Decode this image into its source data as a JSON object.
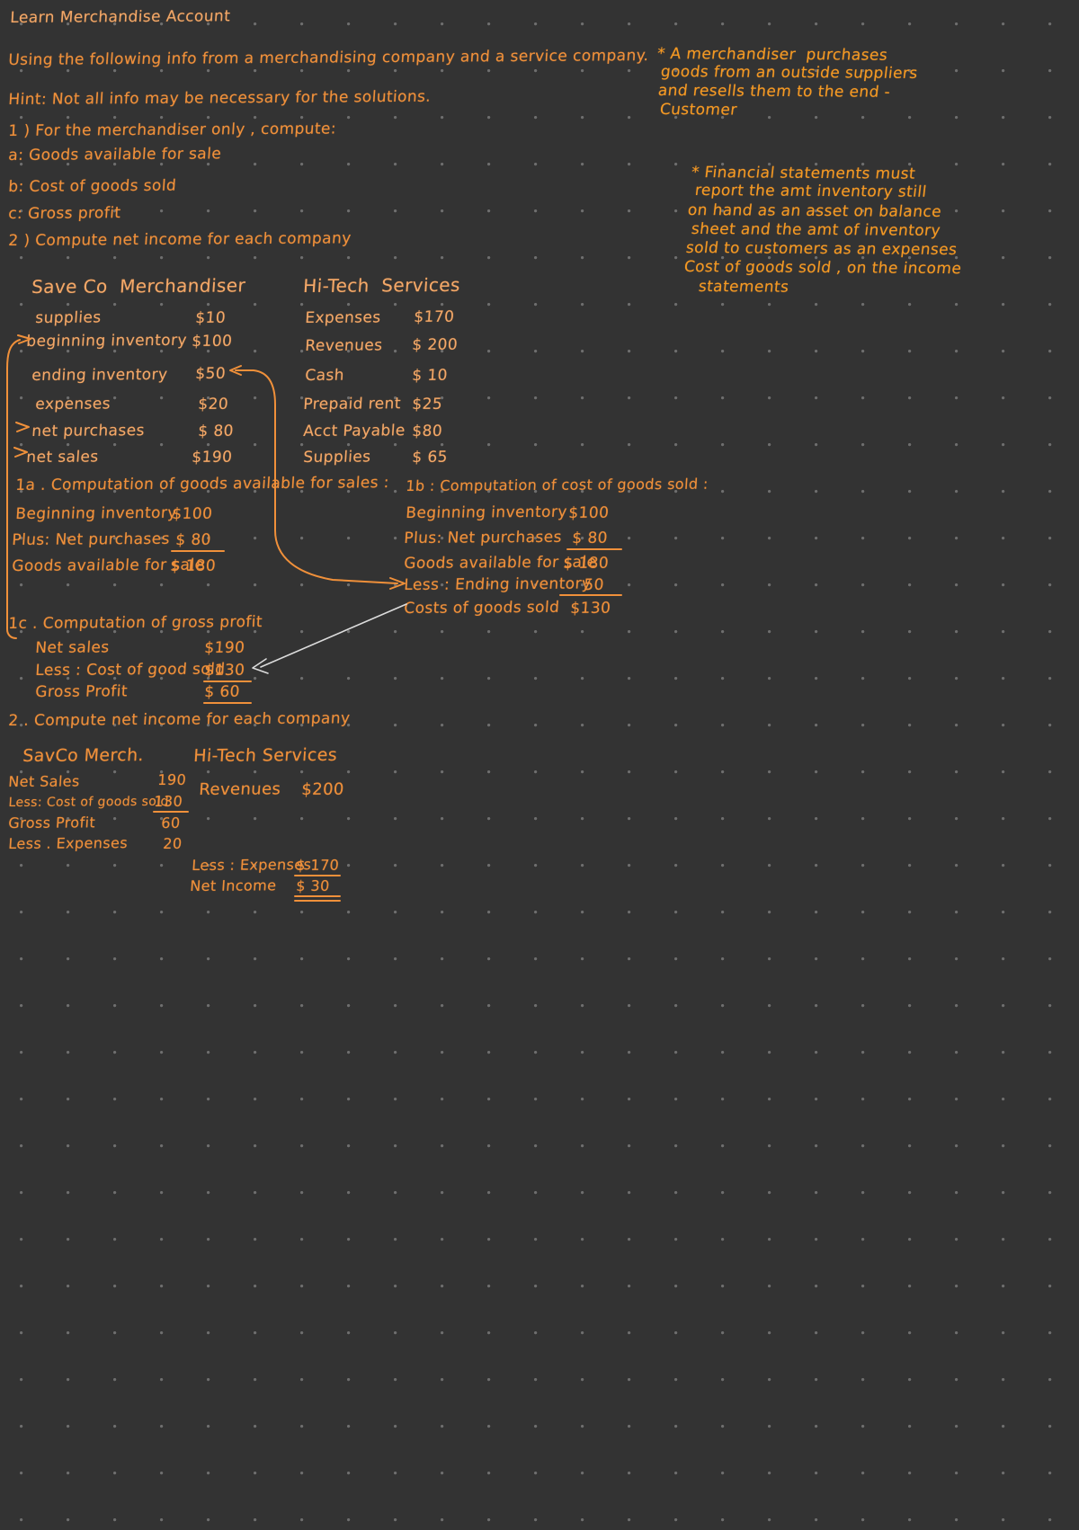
{
  "page": {
    "title": "Learn Merchandise Account",
    "background_color": "#333333",
    "ink_color": "#f0903a",
    "ink_color_bright": "#f59a22",
    "arrow_color": "#dcdcdc"
  },
  "intro": {
    "line1": "Using the following info from a merchandising company and a service company.",
    "line2": "Hint: Not all info may be necessary for the solutions.",
    "q1": "1 ) For the merchandiser only , compute:",
    "q1a": "a: Goods available for sale",
    "q1b": "b: Cost of goods sold",
    "q1c": "c: Gross profit",
    "q2": "2 ) Compute net income for each company"
  },
  "margin_notes": [
    {
      "id": "note-merchandiser",
      "lines": [
        "* A merchandiser  purchases",
        "goods from an outside suppliers",
        "and resells them to the end -",
        "Customer"
      ]
    },
    {
      "id": "note-financial-statements",
      "lines": [
        "* Financial statements must",
        "report the amt inventory still",
        "on hand as an asset on balance",
        "sheet and the amt of inventory",
        "sold to customers as an expenses",
        "Cost of goods sold , on the income",
        "statements"
      ]
    }
  ],
  "given_data": {
    "merchandiser": {
      "heading": "Save Co  Merchandiser",
      "rows": [
        {
          "label": "supplies",
          "value": "$10"
        },
        {
          "label": "beginning inventory",
          "value": "$100"
        },
        {
          "label": "ending inventory",
          "value": "$50"
        },
        {
          "label": "expenses",
          "value": "$20"
        },
        {
          "label": "net purchases",
          "value": "$ 80"
        },
        {
          "label": "net sales",
          "value": "$190"
        }
      ]
    },
    "service": {
      "heading": "Hi-Tech  Services",
      "rows": [
        {
          "label": "Expenses",
          "value": "$170"
        },
        {
          "label": "Revenues",
          "value": "$ 200"
        },
        {
          "label": "Cash",
          "value": "$ 10"
        },
        {
          "label": "Prepaid rent",
          "value": "$25"
        },
        {
          "label": "Acct Payable",
          "value": "$80"
        },
        {
          "label": "Supplies",
          "value": "$ 65"
        }
      ]
    }
  },
  "solution_1a": {
    "heading": "1a . Computation of goods available for sales :",
    "rows": [
      {
        "label": "Beginning inventory",
        "value": "$100"
      },
      {
        "label": "Plus: Net purchases",
        "value": "$ 80"
      },
      {
        "label": "Goods available for sale",
        "value": "$ 180"
      }
    ]
  },
  "solution_1b": {
    "heading": "1b : Computation of cost of goods sold :",
    "rows": [
      {
        "label": "Beginning inventory",
        "value": "$100"
      },
      {
        "label": "Plus: Net purchases",
        "value": "$ 80"
      },
      {
        "label": "Goods available for sale",
        "value": "$ 180"
      },
      {
        "label": "Less : Ending inventory",
        "value": "50"
      },
      {
        "label": "Costs of goods sold",
        "value": "$130"
      }
    ]
  },
  "solution_1c": {
    "heading": "1c . Computation of gross profit",
    "rows": [
      {
        "label": "Net sales",
        "value": "$190"
      },
      {
        "label": "Less : Cost of good sold",
        "value": "$130"
      },
      {
        "label": "Gross Profit",
        "value": "$ 60"
      }
    ]
  },
  "part2": {
    "heading": "2 . Compute net income for each company",
    "merchandiser": {
      "heading": "SavCo Merch.",
      "rows": [
        {
          "label": "Net Sales",
          "value": "190"
        },
        {
          "label": "Less: Cost of goods sold",
          "value": "130"
        },
        {
          "label": "Gross Profit",
          "value": "60"
        },
        {
          "label": "Less . Expenses",
          "value": "20"
        }
      ]
    },
    "service": {
      "heading": "Hi-Tech Services",
      "rows": [
        {
          "label": "Revenues",
          "value": "$200"
        },
        {
          "label": "Less : Expenses",
          "value": "$ 170"
        },
        {
          "label": "Net Income",
          "value": "$ 30"
        }
      ]
    }
  }
}
